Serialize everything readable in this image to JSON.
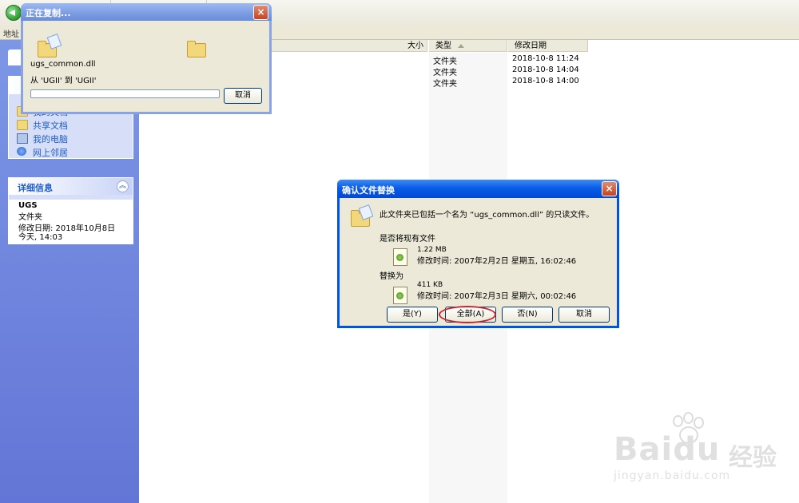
{
  "explorer": {
    "address_label": "地址",
    "columns": {
      "size": "大小",
      "type": "类型",
      "modified": "修改日期"
    },
    "rows": [
      {
        "type": "文件夹",
        "modified": "2018-10-8 11:24"
      },
      {
        "type": "文件夹",
        "modified": "2018-10-8 14:04"
      },
      {
        "type": "文件夹",
        "modified": "2018-10-8 14:00"
      }
    ]
  },
  "taskpane": {
    "links": [
      "我的文档",
      "共享文档",
      "我的电脑",
      "网上邻居"
    ],
    "details": {
      "title": "详细信息",
      "name": "UGS",
      "kind": "文件夹",
      "modified": "修改日期: 2018年10月8日",
      "time": "今天, 14:03"
    }
  },
  "copy_dialog": {
    "title": "正在复制...",
    "filename": "ugs_common.dll",
    "route": "从 'UGII' 到 'UGII'",
    "progress": 0,
    "cancel": "取消"
  },
  "replace_dialog": {
    "title": "确认文件替换",
    "message": "此文件夹已包括一个名为 “ugs_common.dll” 的只读文件。",
    "question": "是否将现有文件",
    "existing": {
      "size": "1.22 MB",
      "modified": "修改时间: 2007年2月2日 星期五, 16:02:46"
    },
    "replace_with": "替换为",
    "new": {
      "size": "411 KB",
      "modified": "修改时间: 2007年2月3日 星期六, 00:02:46"
    },
    "buttons": {
      "yes": "是(Y)",
      "all": "全部(A)",
      "no": "否(N)",
      "cancel": "取消"
    }
  },
  "watermark": {
    "brand": "Bai",
    "brand2": "du",
    "brand_cn": "经验",
    "url": "jingyan.baidu.com"
  },
  "colors": {
    "xp_blue": "#0054e3",
    "pane": "#6f86de",
    "highlight_ring": "#c8262e"
  }
}
